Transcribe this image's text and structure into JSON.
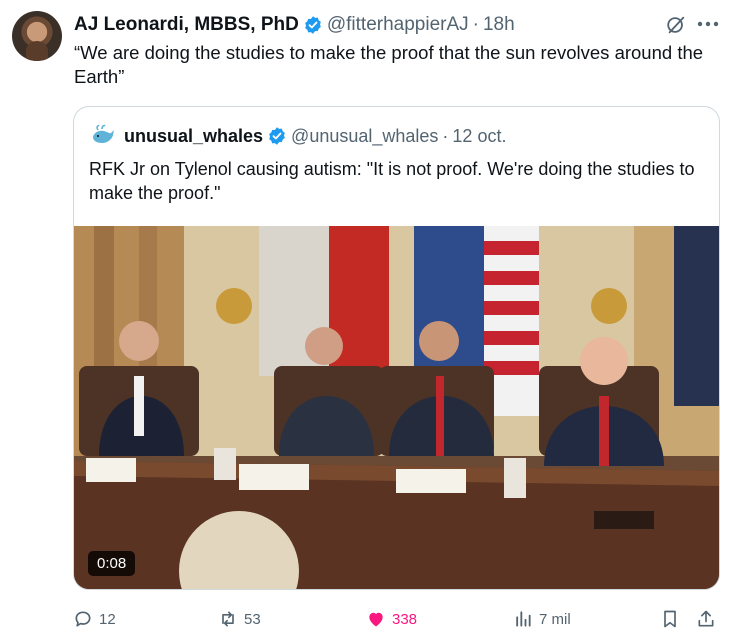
{
  "author": {
    "name": "AJ Leonardi, MBBS, PhD",
    "handle": "@fitterhappierAJ",
    "separator": "·",
    "time": "18h"
  },
  "tweet": {
    "text": "“We are doing the studies to make the proof that the sun revolves around the Earth”"
  },
  "quote": {
    "name": "unusual_whales",
    "handle": "@unusual_whales",
    "separator": "·",
    "time": "12 oct.",
    "text": "RFK Jr on Tylenol causing autism: \"It is not proof. We're doing the studies to make the proof.\"",
    "video_duration": "0:08"
  },
  "actions": {
    "replies": "12",
    "reposts": "53",
    "likes": "338",
    "views": "7 mil"
  },
  "colors": {
    "verified": "#1d9bf0",
    "like": "#f91880",
    "muted": "#536471",
    "border": "#cfd9de"
  },
  "icons": [
    "verified-badge-icon",
    "grok-icon",
    "more-icon",
    "reply-icon",
    "repost-icon",
    "like-heart-icon",
    "views-icon",
    "bookmark-icon",
    "share-icon"
  ]
}
